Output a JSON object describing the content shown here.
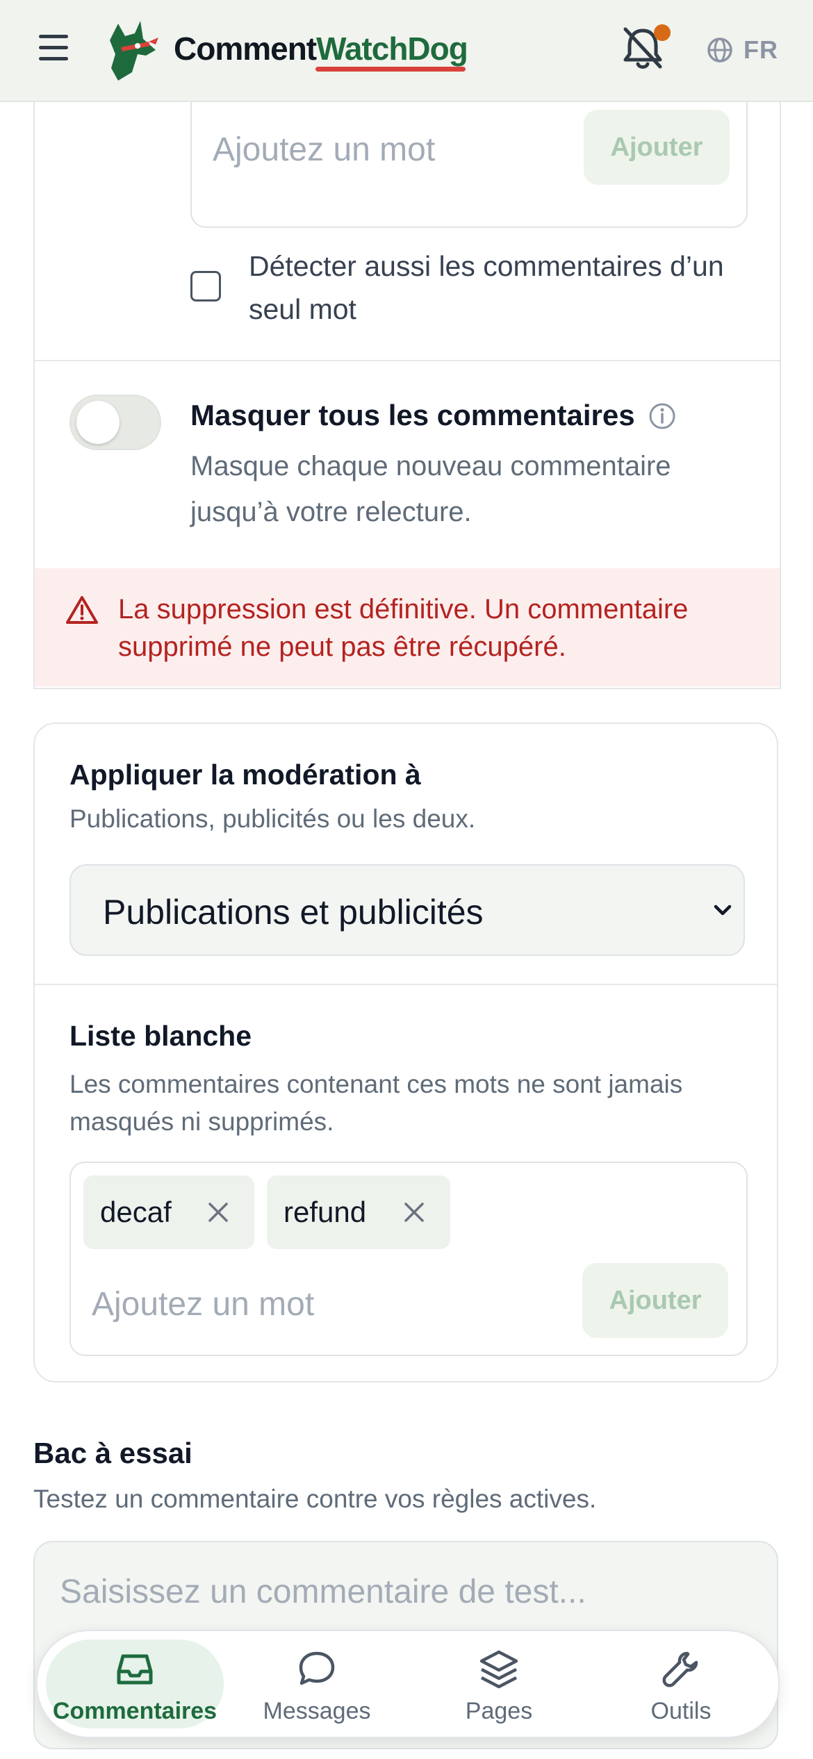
{
  "header": {
    "brand_part1": "Comment",
    "brand_part2": "WatchDog",
    "language": "FR"
  },
  "filter_card": {
    "banned_word_input": {
      "placeholder": "Ajoutez un mot",
      "add_label": "Ajouter"
    },
    "single_word_checkbox": {
      "label": "Détecter aussi les commentaires d’un seul mot",
      "checked": false
    },
    "hide_all": {
      "title": "Masquer tous les commentaires",
      "description": "Masque chaque nouveau commentaire jusqu’à votre relecture.",
      "enabled": false
    },
    "warning": "La suppression est définitive. Un commentaire supprimé ne peut pas être récupéré."
  },
  "scope_card": {
    "apply_title": "Appliquer la modération à",
    "apply_desc": "Publications, publicités ou les deux.",
    "apply_selected": "Publications et publicités",
    "whitelist_title": "Liste blanche",
    "whitelist_desc": "Les commentaires contenant ces mots ne sont jamais masqués ni supprimés.",
    "whitelist_words": [
      "decaf",
      "refund"
    ],
    "whitelist_placeholder": "Ajoutez un mot",
    "whitelist_add_label": "Ajouter"
  },
  "sandbox": {
    "title": "Bac à essai",
    "description": "Testez un commentaire contre vos règles actives.",
    "placeholder": "Saisissez un commentaire de test..."
  },
  "bottom_nav": {
    "items": [
      {
        "label": "Commentaires",
        "icon": "inbox-icon",
        "active": true
      },
      {
        "label": "Messages",
        "icon": "chat-bubble-icon",
        "active": false
      },
      {
        "label": "Pages",
        "icon": "layers-icon",
        "active": false
      },
      {
        "label": "Outils",
        "icon": "wrench-icon",
        "active": false
      }
    ]
  },
  "colors": {
    "brand_green": "#1e6b3d",
    "accent_red": "#d9423a",
    "notification_dot": "#d66a16",
    "warning_text": "#b4231f",
    "warning_bg": "#fdeeee"
  }
}
